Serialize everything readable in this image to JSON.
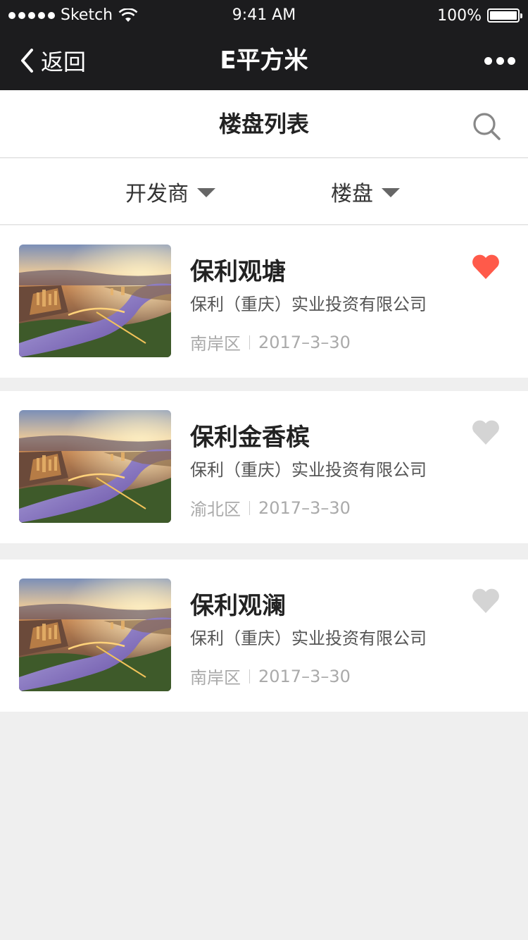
{
  "status_bar": {
    "carrier": "Sketch",
    "time": "9:41 AM",
    "battery": "100%",
    "battery_level": 1.0
  },
  "nav": {
    "back_label": "返回",
    "title": "E平方米"
  },
  "header": {
    "title": "楼盘列表"
  },
  "filters": {
    "developer_label": "开发商",
    "property_label": "楼盘"
  },
  "colors": {
    "dark_bar": "#1c1c1e",
    "heart_active": "#ff5a4a",
    "heart_inactive": "#d4d4d4",
    "page_bg": "#efefef"
  },
  "listings": [
    {
      "name": "保利观塘",
      "company": "保利（重庆）实业投资有限公司",
      "district": "南岸区",
      "date": "2017–3–30",
      "favorited": true
    },
    {
      "name": "保利金香槟",
      "company": "保利（重庆）实业投资有限公司",
      "district": "渝北区",
      "date": "2017–3–30",
      "favorited": false
    },
    {
      "name": "保利观澜",
      "company": "保利（重庆）实业投资有限公司",
      "district": "南岸区",
      "date": "2017–3–30",
      "favorited": false
    }
  ]
}
